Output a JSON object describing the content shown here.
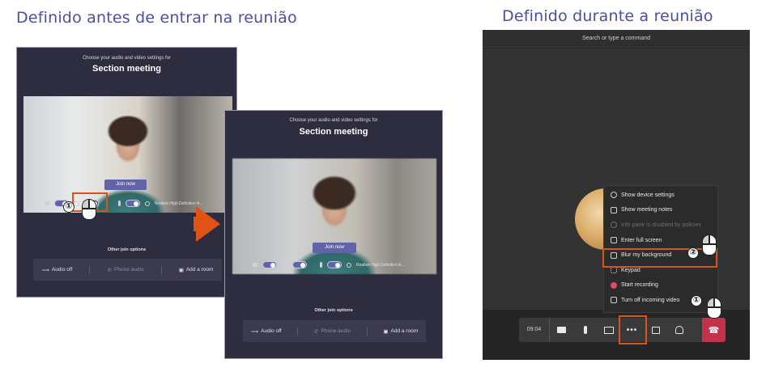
{
  "headings": {
    "left": "Definido antes de entrar na reunião",
    "right": "Definido durante a reunião"
  },
  "prejoin_before": {
    "subtitle": "Choose your audio and video settings for",
    "title": "Section meeting",
    "join_label": "Join now",
    "device_label": "Realtek High Definition A...",
    "other_join_label": "Other join options",
    "options": [
      "Audio off",
      "Phone audio",
      "Add a room"
    ]
  },
  "prejoin_after": {
    "subtitle": "Choose your audio and video settings for",
    "title": "Section meeting",
    "join_label": "Join now",
    "device_label": "Realtek High Definition A...",
    "other_join_label": "Other join options",
    "options": [
      "Audio off",
      "Phone audio",
      "Add a room"
    ]
  },
  "meeting": {
    "command_placeholder": "Search or type a command",
    "menu_items": [
      {
        "label": "Show device settings",
        "icon": "gear-icon",
        "enabled": true
      },
      {
        "label": "Show meeting notes",
        "icon": "notes-icon",
        "enabled": true
      },
      {
        "label": "Info pane is disabled by policies",
        "icon": "info-icon",
        "enabled": false
      },
      {
        "label": "Enter full screen",
        "icon": "fullscreen-icon",
        "enabled": true
      },
      {
        "label": "Blur my background",
        "icon": "blur-background-icon",
        "enabled": true
      },
      {
        "label": "Keypad",
        "icon": "keypad-icon",
        "enabled": true
      },
      {
        "label": "Start recording",
        "icon": "record-icon",
        "enabled": true
      },
      {
        "label": "Turn off incoming video",
        "icon": "video-off-icon",
        "enabled": true
      }
    ],
    "call_time": "09:04",
    "call_buttons": [
      "camera-icon",
      "microphone-icon",
      "share-screen-icon",
      "more-options-icon",
      "chat-icon",
      "participants-icon",
      "hang-up-icon"
    ]
  },
  "steps": {
    "one": "①",
    "two": "②"
  },
  "colors": {
    "heading": "#4a4fa0",
    "teams_bg": "#2e2d3f",
    "accent": "#6264a7",
    "highlight": "#d9531e",
    "arrow": "#e05317",
    "hang_up": "#c4314b"
  }
}
